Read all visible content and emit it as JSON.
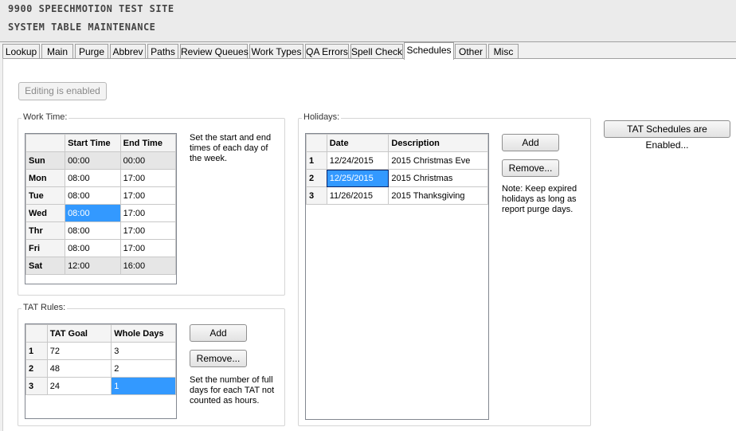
{
  "header": {
    "site": "9900  SPEECHMOTION TEST SITE",
    "subtitle": "SYSTEM TABLE MAINTENANCE"
  },
  "tabs": [
    "Lookup",
    "Main",
    "Purge",
    "Abbrev",
    "Paths",
    "Review Queues",
    "Work Types",
    "QA Errors",
    "Spell Check",
    "Schedules",
    "Other",
    "Misc"
  ],
  "active_tab": "Schedules",
  "editing_button": "Editing is enabled",
  "tat_schedules_button": "TAT Schedules are Enabled...",
  "work_time": {
    "label": "Work Time:",
    "columns": [
      "Start Time",
      "End Time"
    ],
    "rows": [
      {
        "day": "Sun",
        "start": "00:00",
        "end": "00:00"
      },
      {
        "day": "Mon",
        "start": "08:00",
        "end": "17:00"
      },
      {
        "day": "Tue",
        "start": "08:00",
        "end": "17:00"
      },
      {
        "day": "Wed",
        "start": "08:00",
        "end": "17:00"
      },
      {
        "day": "Thr",
        "start": "08:00",
        "end": "17:00"
      },
      {
        "day": "Fri",
        "start": "08:00",
        "end": "17:00"
      },
      {
        "day": "Sat",
        "start": "12:00",
        "end": "16:00"
      }
    ],
    "note": "Set the start and end times of each day of the week."
  },
  "tat_rules": {
    "label": "TAT Rules:",
    "columns": [
      "TAT Goal",
      "Whole Days"
    ],
    "rows": [
      {
        "n": "1",
        "goal": "72",
        "days": "3"
      },
      {
        "n": "2",
        "goal": "48",
        "days": "2"
      },
      {
        "n": "3",
        "goal": "24",
        "days": "1"
      }
    ],
    "add": "Add",
    "remove": "Remove...",
    "note": "Set the number of full days for each TAT not counted as hours."
  },
  "holidays": {
    "label": "Holidays:",
    "columns": [
      "Date",
      "Description"
    ],
    "rows": [
      {
        "n": "1",
        "date": "12/24/2015",
        "desc": "2015 Christmas Eve"
      },
      {
        "n": "2",
        "date": "12/25/2015",
        "desc": "2015 Christmas"
      },
      {
        "n": "3",
        "date": "11/26/2015",
        "desc": "2015 Thanksgiving"
      }
    ],
    "add": "Add",
    "remove": "Remove...",
    "note": "Note: Keep expired holidays as long as report purge days."
  },
  "colors": {
    "selection": "#3399ff",
    "panel": "#ffffff",
    "chrome": "#f0f0f0"
  }
}
